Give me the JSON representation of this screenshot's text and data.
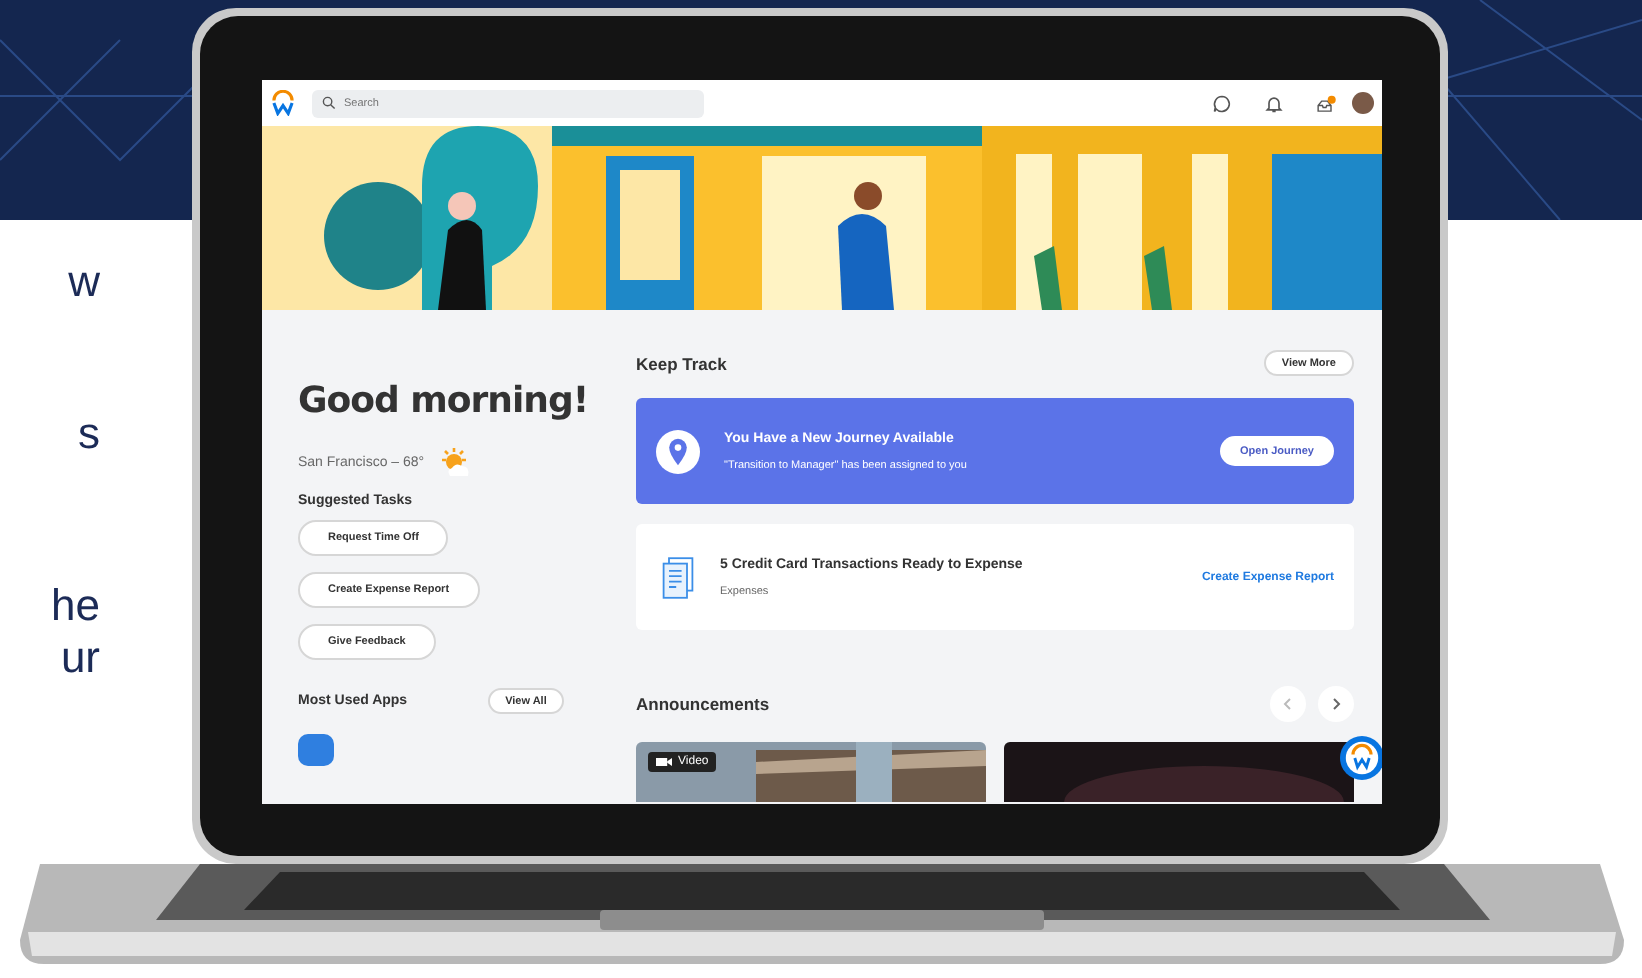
{
  "page": {
    "text_fragments": [
      "w",
      "s",
      "he",
      "ur"
    ]
  },
  "app": {
    "search": {
      "placeholder": "Search"
    },
    "greeting": "Good morning!",
    "weather": "San Francisco – 68°",
    "suggested_tasks": {
      "title": "Suggested Tasks",
      "items": [
        "Request Time Off",
        "Create Expense Report",
        "Give Feedback"
      ]
    },
    "most_used_apps": {
      "title": "Most Used Apps",
      "action": "View All"
    },
    "keep_track": {
      "title": "Keep Track",
      "action": "View More",
      "cards": [
        {
          "kind": "journey",
          "title": "You Have a New Journey Available",
          "subtitle": "\"Transition to Manager\" has been assigned to you",
          "action": "Open Journey"
        },
        {
          "kind": "task",
          "title": "5 Credit Card Transactions Ready to Expense",
          "subtitle": "Expenses",
          "action": "Create Expense Report"
        }
      ]
    },
    "announcements": {
      "title": "Announcements",
      "cards": [
        {
          "kind": "video",
          "badge": "Video"
        },
        {
          "kind": "picture"
        }
      ]
    }
  }
}
